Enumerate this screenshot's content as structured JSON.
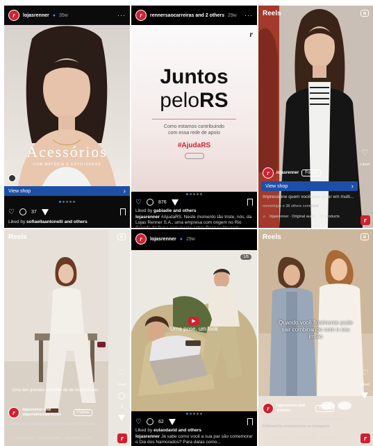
{
  "tiles": [
    {
      "username": "lojasrenner",
      "time": "35w",
      "image_title": "Acessórios",
      "image_subtitle": "COM MATÉRIA E ESTILIZADOS",
      "shop_label": "View shop",
      "comments": "37",
      "liked_by": "Liked by",
      "liked_names": "sofiaellaantonelli and others"
    },
    {
      "username": "rennersaocarreiras and 2 others",
      "time": "29w",
      "headline_line1": "Juntos",
      "headline_line2_prefix": "pelo",
      "headline_line2_suffix": "RS",
      "body": "Como estamos contribuindo com essa rede de apoio",
      "hashtag": "#AjudaRS",
      "likes": "876",
      "liked_by": "Liked by",
      "liked_names": "gabiadie and others",
      "caption_user": "lojasrenner",
      "caption_text": "#AjudaRS. Neste momento tão triste, nós, da Lojas Renner S.A., uma empresa com origem no Rio Grande do Sul e com marca sobre Renner, Youcom..."
    },
    {
      "header": "Reels",
      "username": "lojasrenner",
      "follow": "Follow",
      "shop_label": "View shop",
      "caption": "Impressione quem você ama pular em multi...",
      "sub": "rennerlojas e 38 others comment",
      "audio": "lojasrenner · Original audio",
      "products": "22 products",
      "likes_side": "Liked"
    },
    {
      "header": "Reels",
      "caption_overlay": "Uma das grandes atrações de da moda renner",
      "username": "lojasrenner and imperialmodasrenner",
      "follow": "Follow",
      "caption": "Junte-se a moda que reforça a importância...",
      "audio": "lojasrenner · Original audio",
      "products": "Baseline no PC",
      "likes_side": "Liked",
      "comments_side": "9"
    },
    {
      "username": "lojasrenner",
      "time": "29w",
      "badge": "1/5",
      "overlay": "Uma pose, um look",
      "comments": "62",
      "liked_by": "Liked by",
      "liked_names": "eulaodavid and others",
      "caption_user": "lojasrenner",
      "caption_text": "Já sabe como você a sua par são comemorar o Dia dos Namorados? Para datas como..."
    },
    {
      "header": "Reels",
      "overlay": "Quando você finalmente pode sair combinando com o seu irmão",
      "username": "lojasrenner and vinicius",
      "follow": "Follow",
      "caption": "O Dia dos Namorados chegou chegou de pres...",
      "sub": "Followed by irmaovinicius on Instagram",
      "audio": "lojasrenner · Original audio",
      "products": "24 products",
      "likes_side": "Liked"
    }
  ],
  "colors": {
    "renner_red": "#d2202f",
    "shop_blue": "#1d4fa6",
    "dot_active": "#3b82f6"
  }
}
